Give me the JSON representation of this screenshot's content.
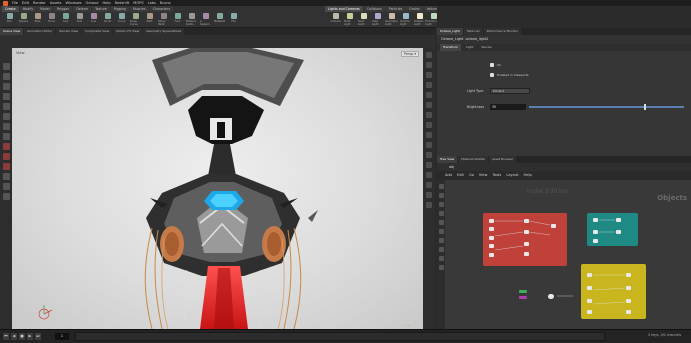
{
  "app": {
    "main_menu": [
      "File",
      "Edit",
      "Render",
      "Assets",
      "Windows",
      "Octane",
      "Help",
      "Redshift",
      "MOPS",
      "Labs",
      "Bruno"
    ]
  },
  "shelf_left": {
    "tabs": [
      "Create",
      "Modify",
      "Model",
      "Polygon",
      "Deform",
      "Texture",
      "Rigging",
      "Muscles",
      "Characters",
      "Constraints",
      "Hair Utils",
      "Guide Process",
      "Terrain FX",
      "Simple FX",
      "Volume"
    ],
    "tools": [
      "Box",
      "Sphere",
      "Tube",
      "Torus",
      "Grid",
      "Null",
      "Line",
      "Circle",
      "Curve",
      "Draw Curve",
      "Path",
      "Spray Paint",
      "Font",
      "Platonic Solids",
      "L-System",
      "Metaball",
      "File"
    ]
  },
  "shelf_right": {
    "tabs": [
      "Lights and Cameras",
      "Collisions",
      "Particles",
      "Grains",
      "Vellum",
      "Rigid Bodies",
      "Particle Fluids",
      "Viscous Fluids",
      "Oceans",
      "Pyro FX",
      "FEM",
      "Wires",
      "Crowds",
      "Drive Simulation"
    ],
    "tools": [
      "Camera",
      "Point Light",
      "Spot Light",
      "Area Light",
      "Geometry Light",
      "Volume Light",
      "Distant Light",
      "Environment Light",
      "Sky Light",
      "GI Light",
      "Caustic Light",
      "Portal Light",
      "Ambient Light",
      "Stereo Camera",
      "VR Camera",
      "Switcher",
      "Gamepad Camera"
    ]
  },
  "left_pane_tabs": [
    "Scene View",
    "Animation Editor",
    "Render View",
    "Composite View",
    "Motion FX View",
    "Geometry Spreadsheet"
  ],
  "viewport": {
    "path": "obj",
    "view_label": "View",
    "camera_menu": "Persp ▾",
    "cam_menu2": "No cam ▾"
  },
  "right_pane_tabs": [
    "Octane_Light",
    "Take List",
    "Performance Monitor"
  ],
  "params": {
    "header_type": "Octane_Light",
    "header_name": "octane_light2",
    "sub_tabs": [
      "Transform",
      "Light",
      "Render"
    ],
    "enable_label": "On",
    "viewport_label": "Enabled in Viewports",
    "light_type_label": "Light Type",
    "light_type_value": "Circle",
    "brightness_label": "Brightness",
    "brightness_value": "35",
    "brightness_fraction": 0.75
  },
  "network": {
    "tabs": [
      "Tree View",
      "Material Palette",
      "Asset Browser"
    ],
    "path": "obj",
    "menu": [
      "Add",
      "Edit",
      "Go",
      "View",
      "Tools",
      "Layout",
      "Help"
    ],
    "watermark": "Indie Edition",
    "context_label": "Objects"
  },
  "timeline": {
    "frame": "1",
    "status": "0 keys, 0/0 channels"
  },
  "colors": {
    "accent_orange": "#e8612c",
    "net_red": "#c0413a",
    "net_teal": "#1f8a84",
    "net_yellow": "#c9b61e",
    "slider_blue": "#5b7fb0"
  }
}
